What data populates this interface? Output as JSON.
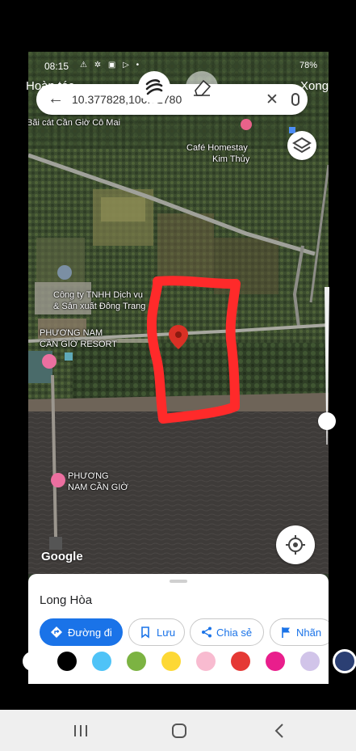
{
  "status_bar": {
    "time": "08:15",
    "left_icons": "⚠ ✲ ▣ ▷ •",
    "battery": "78%"
  },
  "drawing_toolbar": {
    "undo_label": "Hoàn tác",
    "done_label": "Xong",
    "pen_icon": "scribble-icon",
    "eraser_icon": "eraser-icon"
  },
  "search": {
    "query": "10.377828,106.92780"
  },
  "map_labels": {
    "beach": "Bãi cát Cần Giờ Cô Mai",
    "homestay_line1": "Café Homestay",
    "homestay_line2": "Kim Thủy",
    "company_line1": "Công ty TNHH Dịch vụ",
    "company_line2": "& Sản xuất Đông Trang",
    "resort_line1": "PHƯƠNG NAM",
    "resort_line2": "CẦN GIỜ RESORT",
    "pn_line1": "PHƯƠNG",
    "pn_line2": "NAM CẦN GIỜ",
    "google": "Google"
  },
  "place_sheet": {
    "name": "Long Hòa",
    "actions": [
      {
        "label": "Đường đi",
        "icon": "directions-icon"
      },
      {
        "label": "Lưu",
        "icon": "bookmark-icon"
      },
      {
        "label": "Chia sẻ",
        "icon": "share-icon"
      },
      {
        "label": "Nhãn",
        "icon": "flag-icon"
      }
    ]
  },
  "palette": {
    "colors": [
      "#ffffff",
      "#000000",
      "#4fc3f7",
      "#7cb342",
      "#fdd835",
      "#f8bbd0",
      "#e53935",
      "#e91e8c",
      "#d1c4e9",
      "#2b3f73"
    ],
    "selected": "#2b3f73"
  },
  "pen_size": 0.15,
  "accent": "#1a73e8",
  "drawing_color": "#ff2a2a"
}
